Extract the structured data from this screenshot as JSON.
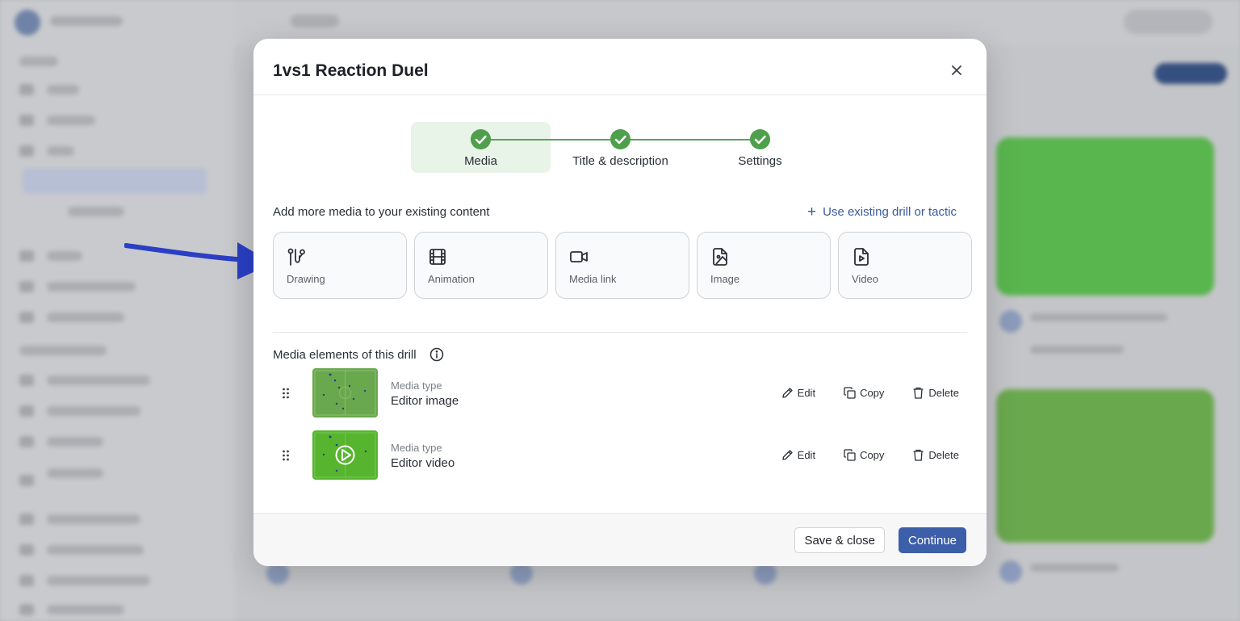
{
  "modal": {
    "title": "1vs1 Reaction Duel"
  },
  "stepper": {
    "steps": [
      {
        "label": "Media",
        "state": "completed-active"
      },
      {
        "label": "Title & description",
        "state": "completed"
      },
      {
        "label": "Settings",
        "state": "completed"
      }
    ],
    "accent_color": "#4fa04c"
  },
  "add_media": {
    "label": "Add more media to your existing content",
    "use_existing_label": "Use existing drill or tactic",
    "types": [
      {
        "label": "Drawing",
        "icon": "drawing-icon"
      },
      {
        "label": "Animation",
        "icon": "film-icon"
      },
      {
        "label": "Media link",
        "icon": "video-camera-icon"
      },
      {
        "label": "Image",
        "icon": "image-file-icon"
      },
      {
        "label": "Video",
        "icon": "video-file-icon"
      }
    ]
  },
  "media_elements": {
    "label": "Media elements of this drill",
    "items": [
      {
        "type_label": "Media type",
        "type_value": "Editor image"
      },
      {
        "type_label": "Media type",
        "type_value": "Editor video"
      }
    ],
    "actions": {
      "edit": "Edit",
      "copy": "Copy",
      "delete": "Delete"
    }
  },
  "footer": {
    "save_close": "Save & close",
    "continue": "Continue"
  },
  "colors": {
    "primary": "#3d5ea8",
    "link": "#3a5a9e",
    "arrow": "#2a3fc4"
  }
}
